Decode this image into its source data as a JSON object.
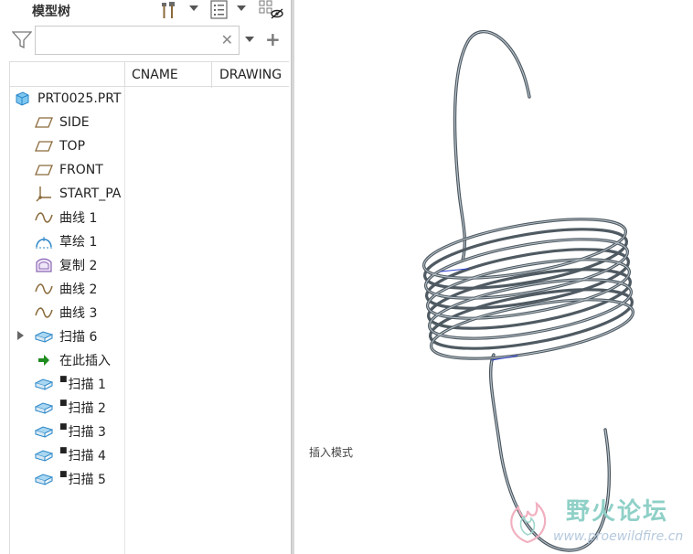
{
  "panel": {
    "title": "模型树"
  },
  "toolbar": {
    "icons": [
      "settings-tools-icon",
      "tree-options-icon",
      "show-hidden-icon"
    ]
  },
  "search": {
    "value": "",
    "placeholder": ""
  },
  "columns": [
    "CNAME",
    "DRAWING"
  ],
  "tree": {
    "root": "PRT0025.PRT",
    "items": [
      {
        "label": "SIDE",
        "icon": "datum-plane-icon"
      },
      {
        "label": "TOP",
        "icon": "datum-plane-icon"
      },
      {
        "label": "FRONT",
        "icon": "datum-plane-icon"
      },
      {
        "label": "START_PA",
        "icon": "coordinate-system-icon"
      },
      {
        "label": "曲线 1",
        "icon": "curve-icon"
      },
      {
        "label": "草绘 1",
        "icon": "sketch-icon"
      },
      {
        "label": "复制 2",
        "icon": "copy-surface-icon"
      },
      {
        "label": "曲线 2",
        "icon": "curve-icon"
      },
      {
        "label": "曲线 3",
        "icon": "curve-icon"
      },
      {
        "label": "扫描 6",
        "icon": "sweep-icon"
      },
      {
        "label": "在此插入",
        "icon": "insert-here-arrow-icon"
      },
      {
        "label": "扫描 1",
        "icon": "sweep-icon"
      },
      {
        "label": "扫描 2",
        "icon": "sweep-icon"
      },
      {
        "label": "扫描 3",
        "icon": "sweep-icon"
      },
      {
        "label": "扫描 4",
        "icon": "sweep-icon"
      },
      {
        "label": "扫描 5",
        "icon": "sweep-icon"
      }
    ]
  },
  "viewport": {
    "mode_text": "插入模式"
  },
  "watermark": {
    "title": "野火论坛",
    "url": "www.proewildfire.cn"
  }
}
